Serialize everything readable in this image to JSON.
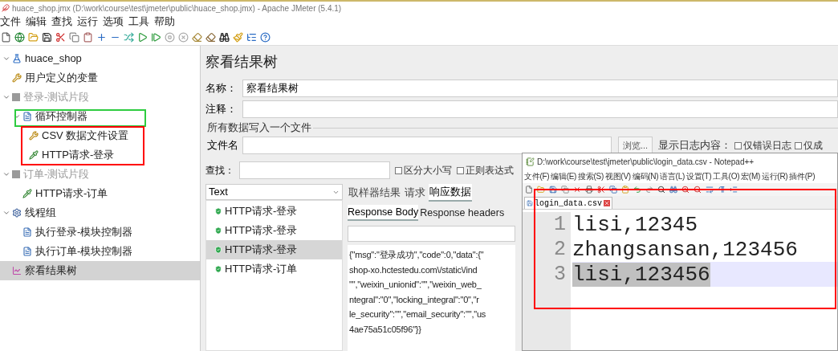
{
  "window": {
    "title": "huace_shop.jmx (D:\\work\\course\\test\\jmeter\\public\\huace_shop.jmx) - Apache JMeter (5.4.1)"
  },
  "menu": [
    "文件",
    "编辑",
    "查找",
    "运行",
    "选项",
    "工具",
    "帮助"
  ],
  "tree": [
    {
      "label": "huace_shop",
      "kind": "plan",
      "expanded": true,
      "selected": false,
      "disabled": false,
      "children": [
        {
          "label": "用户定义的变量",
          "kind": "config",
          "selected": false,
          "disabled": false
        },
        {
          "label": "登录-测试片段",
          "kind": "fragment",
          "expanded": true,
          "selected": false,
          "disabled": true,
          "children": [
            {
              "label": "循环控制器",
              "kind": "controller",
              "expanded": true,
              "selected": false,
              "disabled": false,
              "children": [
                {
                  "label": "CSV 数据文件设置",
                  "kind": "config",
                  "selected": false,
                  "disabled": false
                },
                {
                  "label": "HTTP请求-登录",
                  "kind": "sampler",
                  "selected": false,
                  "disabled": false
                }
              ]
            }
          ]
        },
        {
          "label": "订单-测试片段",
          "kind": "fragment",
          "expanded": true,
          "selected": false,
          "disabled": true,
          "children": [
            {
              "label": "HTTP请求-订单",
              "kind": "sampler",
              "selected": false,
              "disabled": false
            }
          ]
        },
        {
          "label": "线程组",
          "kind": "threads",
          "expanded": true,
          "selected": false,
          "disabled": false,
          "children": [
            {
              "label": "执行登录-模块控制器",
              "kind": "controller",
              "selected": false,
              "disabled": false
            },
            {
              "label": "执行订单-模块控制器",
              "kind": "controller",
              "selected": false,
              "disabled": false
            }
          ]
        },
        {
          "label": "察看结果树",
          "kind": "listener",
          "selected": true,
          "disabled": false
        }
      ]
    }
  ],
  "panel": {
    "title": "察看结果树",
    "name_label": "名称：",
    "name_value": "察看结果树",
    "comment_label": "注释：",
    "file_group": "所有数据写入一个文件",
    "file_label": "文件名",
    "browse_button": "浏览...",
    "log_label": "显示日志内容：",
    "log_options": [
      {
        "label": "仅错误日志",
        "checked": false
      },
      {
        "label": "仅成",
        "checked": false
      }
    ],
    "search_label": "查找：",
    "search_options": [
      {
        "label": "区分大小写",
        "checked": false
      },
      {
        "label": "正则表达式",
        "checked": false
      }
    ]
  },
  "results": {
    "renderer": "Text",
    "items": [
      {
        "label": "HTTP请求-登录",
        "ok": true,
        "selected": false
      },
      {
        "label": "HTTP请求-登录",
        "ok": true,
        "selected": false
      },
      {
        "label": "HTTP请求-登录",
        "ok": true,
        "selected": true
      },
      {
        "label": "HTTP请求-订单",
        "ok": true,
        "selected": false
      }
    ],
    "tabs": [
      {
        "label": "取样器结果",
        "selected": false
      },
      {
        "label": "请求",
        "selected": false
      },
      {
        "label": "响应数据",
        "selected": true
      }
    ],
    "subtabs": [
      {
        "label": "Response Body",
        "selected": true
      },
      {
        "label": "Response headers",
        "selected": false
      }
    ],
    "body_lines": [
      "{\"msg\":\"登录成功\",\"code\":0,\"data\":{\"",
      "shop-xo.hctestedu.com\\/static\\/ind",
      "\"\",\"weixin_unionid\":\"\",\"weixin_web_",
      "ntegral\":\"0\",\"locking_integral\":\"0\",\"r",
      "le_security\":\"\",\"email_security\":\"\",\"us",
      "4ae75a51c05f96\"}}"
    ]
  },
  "notepad": {
    "title": "D:\\work\\course\\test\\jmeter\\public\\login_data.csv - Notepad++",
    "menu": [
      "文件(F)",
      "编辑(E)",
      "搜索(S)",
      "视图(V)",
      "编码(N)",
      "语言(L)",
      "设置(T)",
      "工具(O)",
      "宏(M)",
      "运行(R)",
      "插件(P)"
    ],
    "tab": "login_data.csv",
    "lines": [
      {
        "number": "1",
        "text": "lisi,12345",
        "selected": false
      },
      {
        "number": "2",
        "text": "zhangsansan,123456",
        "selected": false
      },
      {
        "number": "3",
        "text": "lisi,123456",
        "selected": true
      }
    ]
  },
  "annotations": [
    {
      "color": "#2ecc40"
    },
    {
      "color": "#ff0000"
    },
    {
      "color": "#ff0000"
    }
  ]
}
